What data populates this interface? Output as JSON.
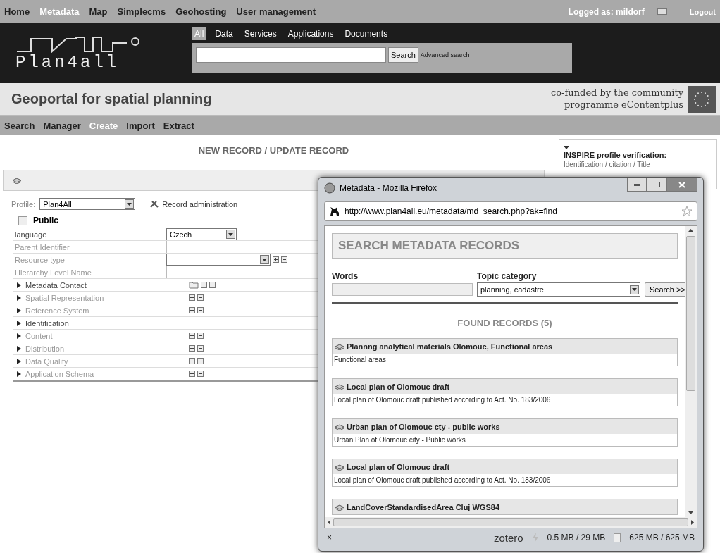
{
  "top_nav": {
    "items": [
      {
        "label": "Home",
        "selected": false
      },
      {
        "label": "Metadata",
        "selected": true
      },
      {
        "label": "Map",
        "selected": false
      },
      {
        "label": "Simplecms",
        "selected": false
      },
      {
        "label": "Geohosting",
        "selected": false
      },
      {
        "label": "User management",
        "selected": false
      }
    ],
    "logged_label": "Logged as:",
    "user": "mildorf",
    "logout": "Logout"
  },
  "header": {
    "logo_text": "Plan4all",
    "search_tabs": [
      {
        "label": "All",
        "selected": true
      },
      {
        "label": "Data",
        "selected": false
      },
      {
        "label": "Services",
        "selected": false
      },
      {
        "label": "Applications",
        "selected": false
      },
      {
        "label": "Documents",
        "selected": false
      }
    ],
    "search_button": "Search",
    "advanced": "Advanced search"
  },
  "title_band": {
    "title": "Geoportal for spatial planning",
    "cofunded": [
      "co-funded by the community",
      "programme eContentplus"
    ]
  },
  "sub_nav": [
    {
      "label": "Search",
      "selected": false
    },
    {
      "label": "Manager",
      "selected": false
    },
    {
      "label": "Create",
      "selected": true
    },
    {
      "label": "Import",
      "selected": false
    },
    {
      "label": "Extract",
      "selected": false
    }
  ],
  "page_heading": "NEW RECORD / UPDATE RECORD",
  "form": {
    "profile_label": "Profile:",
    "profile_value": "Plan4All",
    "record_admin": "Record administration",
    "public": {
      "label": "Public",
      "checked": false
    },
    "fields": [
      {
        "label": "language",
        "kind": "select",
        "value": "Czech"
      },
      {
        "label": "Parent Identifier",
        "kind": "input"
      },
      {
        "label": "Resource type",
        "kind": "select_actions"
      },
      {
        "label": "Hierarchy Level Name",
        "kind": "input"
      }
    ],
    "sections": [
      {
        "label": "Metadata Contact",
        "disabled": false,
        "kind": "folder_actions"
      },
      {
        "label": "Spatial Representation",
        "disabled": true,
        "kind": "actions"
      },
      {
        "label": "Reference System",
        "disabled": true,
        "kind": "actions"
      },
      {
        "label": "Identification",
        "disabled": false,
        "kind": "none"
      },
      {
        "label": "Content",
        "disabled": true,
        "kind": "actions"
      },
      {
        "label": "Distribution",
        "disabled": true,
        "kind": "actions"
      },
      {
        "label": "Data Quality",
        "disabled": true,
        "kind": "actions"
      },
      {
        "label": "Application Schema",
        "disabled": true,
        "kind": "actions"
      }
    ]
  },
  "inspire_panel": {
    "title": "INSPIRE profile verification:",
    "line": "Identification / citation / Title"
  },
  "popup": {
    "title": "Metadata - Mozilla Firefox",
    "url": "http://www.plan4all.eu/metadata/md_search.php?ak=find",
    "heading": "SEARCH METADATA RECORDS",
    "words_label": "Words",
    "topic_label": "Topic category",
    "topic_value": "planning, cadastre",
    "search_button": "Search >>",
    "found": "FOUND RECORDS (5)",
    "records": [
      {
        "title": "Plannng analytical materials Olomouc, Functional areas",
        "abstract": "Functional areas"
      },
      {
        "title": "Local plan of Olomouc draft",
        "abstract": "Local plan of Olomouc draft published according to Act. No. 183/2006"
      },
      {
        "title": "Urban plan of Olomouc cty - public works",
        "abstract": "Urban Plan of Olomouc city - Public works"
      },
      {
        "title": "Local plan of Olomouc draft",
        "abstract": "Local plan of Olomouc draft published according to Act. No. 183/2006"
      },
      {
        "title": "LandCoverStandardisedArea Cluj WGS84"
      }
    ],
    "status": {
      "close": "×",
      "zotero": "zotero",
      "memory": "0.5 MB / 29 MB",
      "disk": "625 MB / 625 MB"
    }
  }
}
